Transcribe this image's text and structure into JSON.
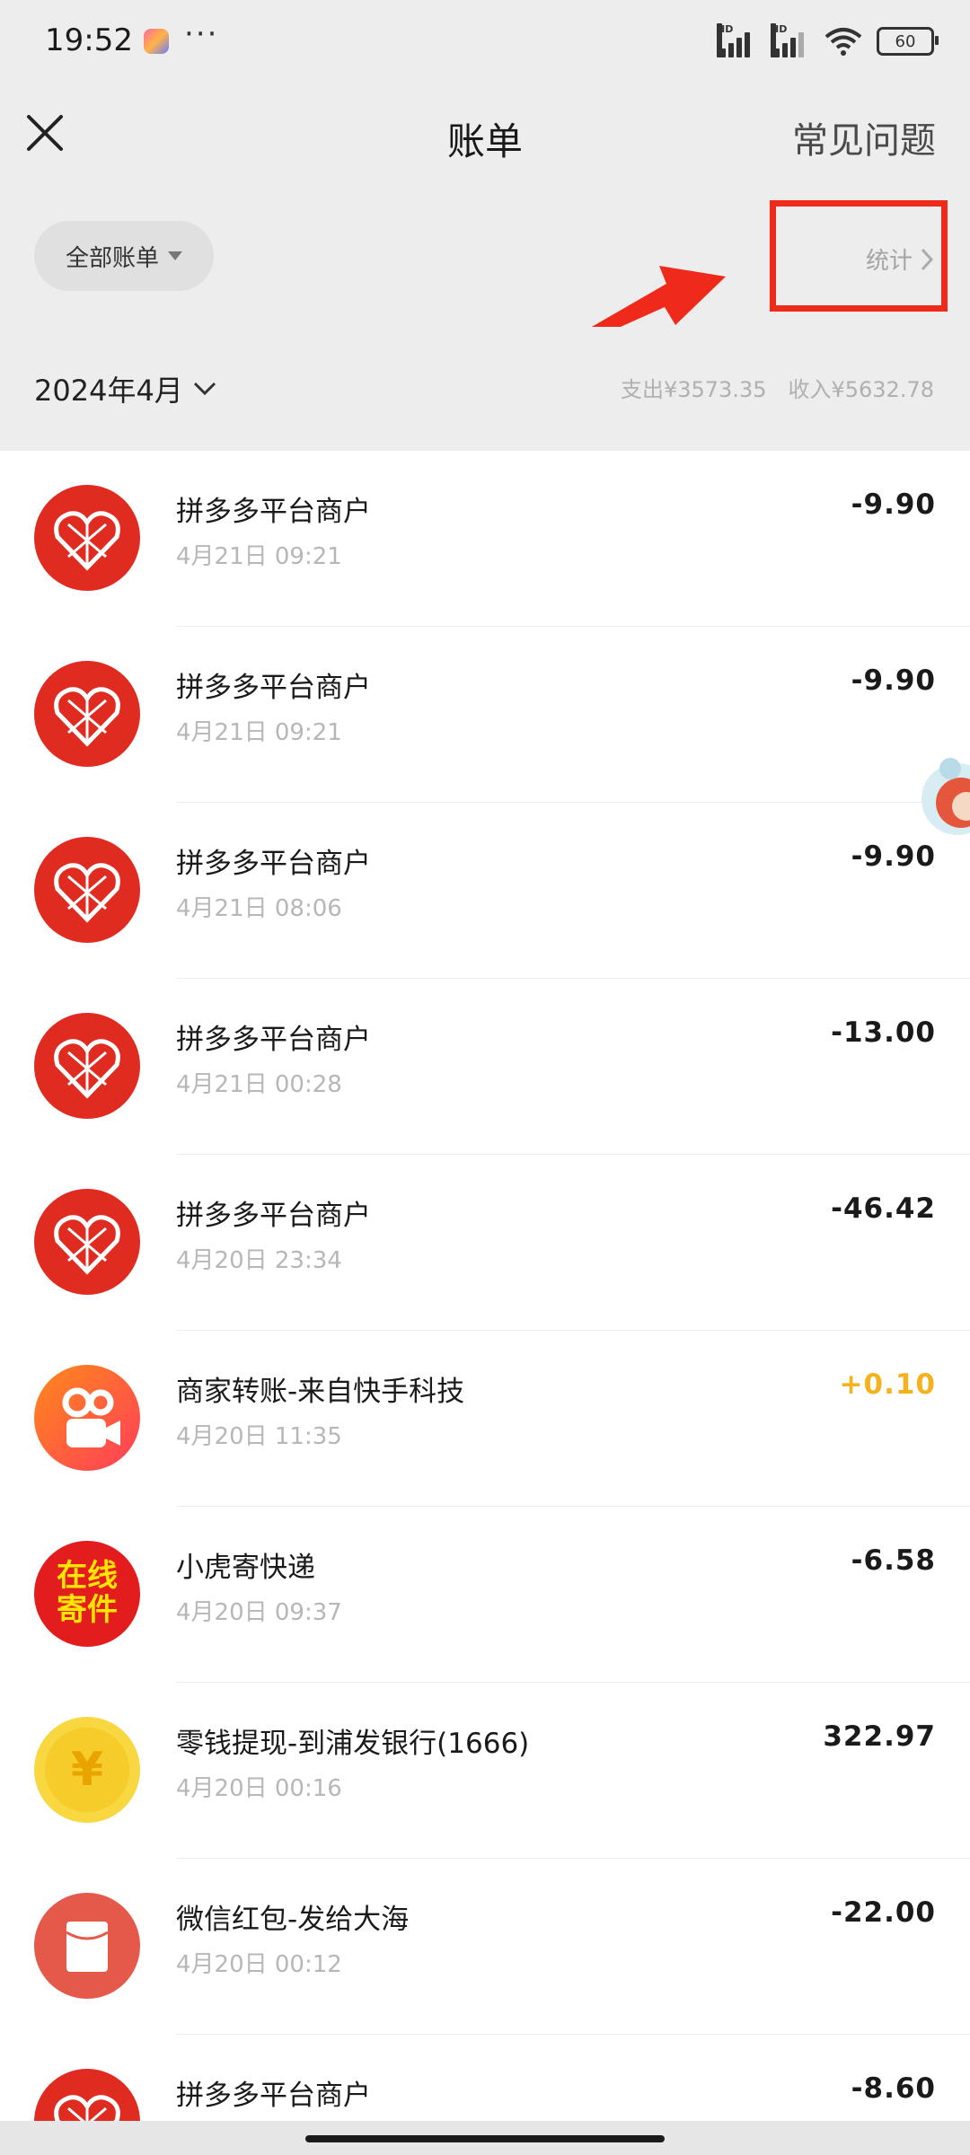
{
  "status_bar": {
    "time": "19:52",
    "more": "···",
    "battery": "60"
  },
  "header": {
    "title": "账单",
    "faq": "常见问题"
  },
  "filter": {
    "label": "全部账单",
    "stats": "统计"
  },
  "month": {
    "label": "2024年4月",
    "expense": "支出¥3573.35",
    "income": "收入¥5632.78"
  },
  "transactions": [
    {
      "name": "拼多多平台商户",
      "time": "4月21日 09:21",
      "amount": "-9.90",
      "icon": "pinduoduo-logo"
    },
    {
      "name": "拼多多平台商户",
      "time": "4月21日 09:21",
      "amount": "-9.90",
      "icon": "pinduoduo-logo"
    },
    {
      "name": "拼多多平台商户",
      "time": "4月21日 08:06",
      "amount": "-9.90",
      "icon": "pinduoduo-logo"
    },
    {
      "name": "拼多多平台商户",
      "time": "4月21日 00:28",
      "amount": "-13.00",
      "icon": "pinduoduo-logo"
    },
    {
      "name": "拼多多平台商户",
      "time": "4月20日 23:34",
      "amount": "-46.42",
      "icon": "pinduoduo-logo"
    },
    {
      "name": "商家转账-来自快手科技",
      "time": "4月20日 11:35",
      "amount": "+0.10",
      "icon": "kuaishou-logo"
    },
    {
      "name": "小虎寄快递",
      "time": "4月20日 09:37",
      "amount": "-6.58",
      "icon": "online-shipping-logo",
      "badge": [
        "在线",
        "寄件"
      ]
    },
    {
      "name": "零钱提现-到浦发银行(1666)",
      "time": "4月20日 00:16",
      "amount": "322.97",
      "icon": "yuan-coin-icon",
      "badge": [
        "¥"
      ]
    },
    {
      "name": "微信红包-发给大海",
      "time": "4月20日 00:12",
      "amount": "-22.00",
      "icon": "red-packet-icon"
    },
    {
      "name": "拼多多平台商户",
      "time": "",
      "amount": "-8.60",
      "icon": "pinduoduo-logo"
    }
  ],
  "colors": {
    "accent_red": "#f02a1a",
    "income": "#f5b21c",
    "pdd_red": "#e02b20"
  }
}
